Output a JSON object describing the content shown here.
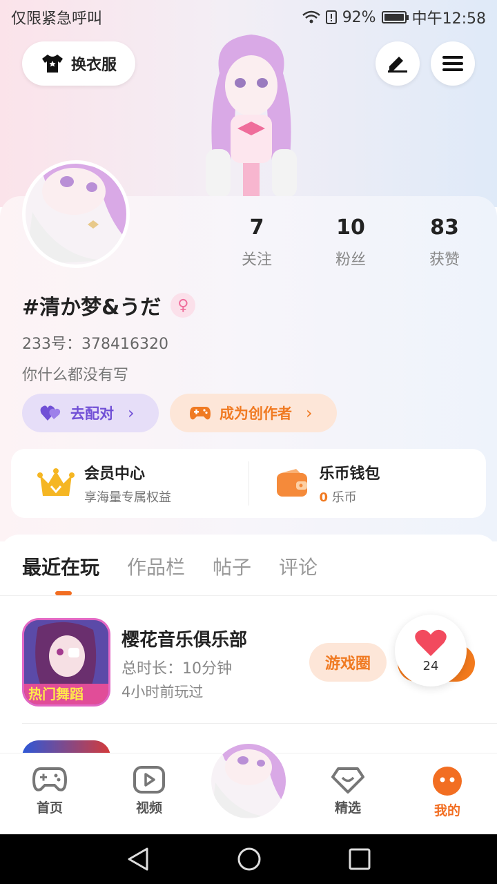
{
  "status_bar": {
    "left_text": "仅限紧急呼叫",
    "battery": "92%",
    "time": "中午12:58"
  },
  "header": {
    "change_outfit_label": "换衣服"
  },
  "stats": [
    {
      "value": "7",
      "label": "关注"
    },
    {
      "value": "10",
      "label": "粉丝"
    },
    {
      "value": "83",
      "label": "获赞"
    }
  ],
  "profile": {
    "username": "#清か梦&うだ",
    "gender_symbol": "♀",
    "uid": "233号：378416320",
    "bio": "你什么都没有写"
  },
  "actions": {
    "match_label": "去配对",
    "creator_label": "成为创作者",
    "chevron": "›"
  },
  "member": {
    "center_title": "会员中心",
    "center_sub": "享海量专属权益",
    "wallet_title": "乐币钱包",
    "wallet_amount": "0",
    "wallet_unit": " 乐币"
  },
  "tabs": [
    "最近在玩",
    "作品栏",
    "帖子",
    "评论"
  ],
  "games": [
    {
      "name": "樱花音乐俱乐部",
      "duration": "总时长：10分钟",
      "last_played": "4小时前玩过",
      "circle_label": "游戏圈",
      "icon_text": "热门舞蹈"
    }
  ],
  "like_bubble": {
    "count": "24"
  },
  "bottom_nav": [
    "首页",
    "视频",
    "精选",
    "我的"
  ],
  "colors": {
    "accent": "#f26e22",
    "purple": "#7150d6",
    "pink": "#ef6d9b"
  }
}
